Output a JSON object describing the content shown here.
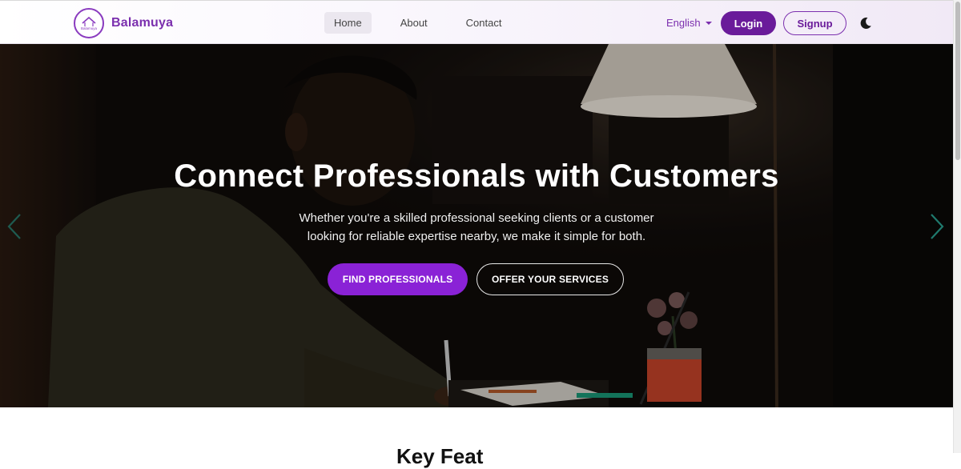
{
  "nav": {
    "brand": "Balamuya",
    "logo_text": "Balamuya",
    "links": [
      {
        "label": "Home",
        "active": true
      },
      {
        "label": "About",
        "active": false
      },
      {
        "label": "Contact",
        "active": false
      }
    ],
    "language": "English",
    "login_label": "Login",
    "signup_label": "Signup",
    "theme_icon": "moon-icon"
  },
  "hero": {
    "title": "Connect Professionals with Customers",
    "subtitle_line1": "Whether you're a skilled professional seeking clients or a customer",
    "subtitle_line2": "looking for reliable expertise nearby, we make it simple for both.",
    "primary_cta": "FIND PROFESSIONALS",
    "secondary_cta": "OFFER YOUR SERVICES",
    "prev_icon": "chevron-left-icon",
    "next_icon": "chevron-right-icon"
  },
  "section": {
    "partial_title": "Key Feat"
  },
  "colors": {
    "brand_purple": "#6a1b9a",
    "cta_purple": "#8a22d6",
    "accent_text": "#7b2fae",
    "carousel_arrow": "#1f7a6e"
  }
}
